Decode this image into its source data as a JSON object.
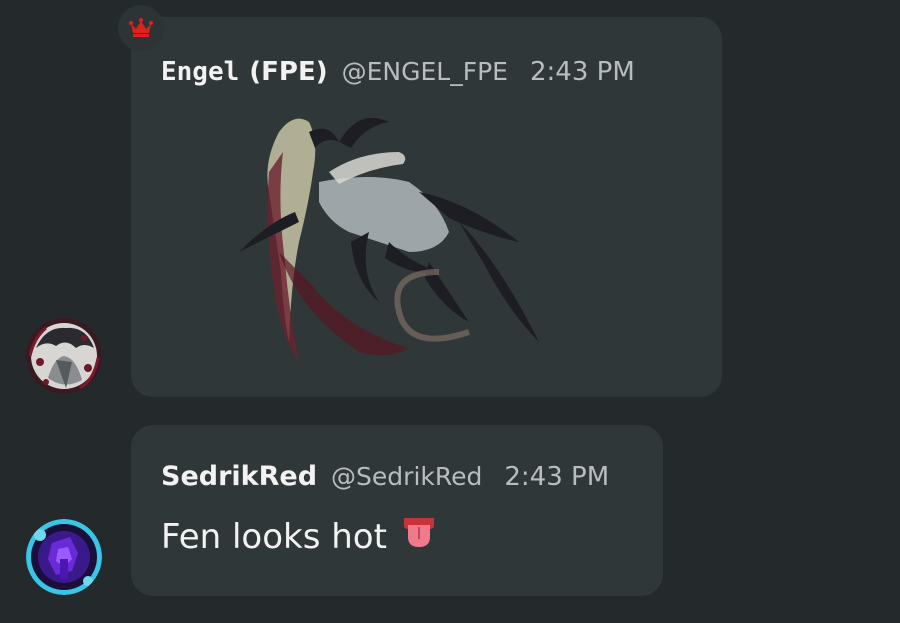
{
  "messages": [
    {
      "author_mono": "Engel",
      "author_tag": "(FPE)",
      "handle": "@ENGEL_FPE",
      "time": "2:43 PM",
      "badge_icon": "crown-icon",
      "avatar_icon": "engel-avatar",
      "attachment": "character-art-image"
    },
    {
      "author": "SedrikRed",
      "handle": "@SedrikRed",
      "time": "2:43 PM",
      "text": "Fen looks hot",
      "emoji_icon": "tongue-emoji-icon",
      "avatar_icon": "sedrikred-avatar"
    }
  ],
  "colors": {
    "background": "#242a2b",
    "bubble": "#303738",
    "crown": "#e0201b",
    "name_text": "#f2f2f2",
    "meta_text": "#b9bdbe"
  }
}
